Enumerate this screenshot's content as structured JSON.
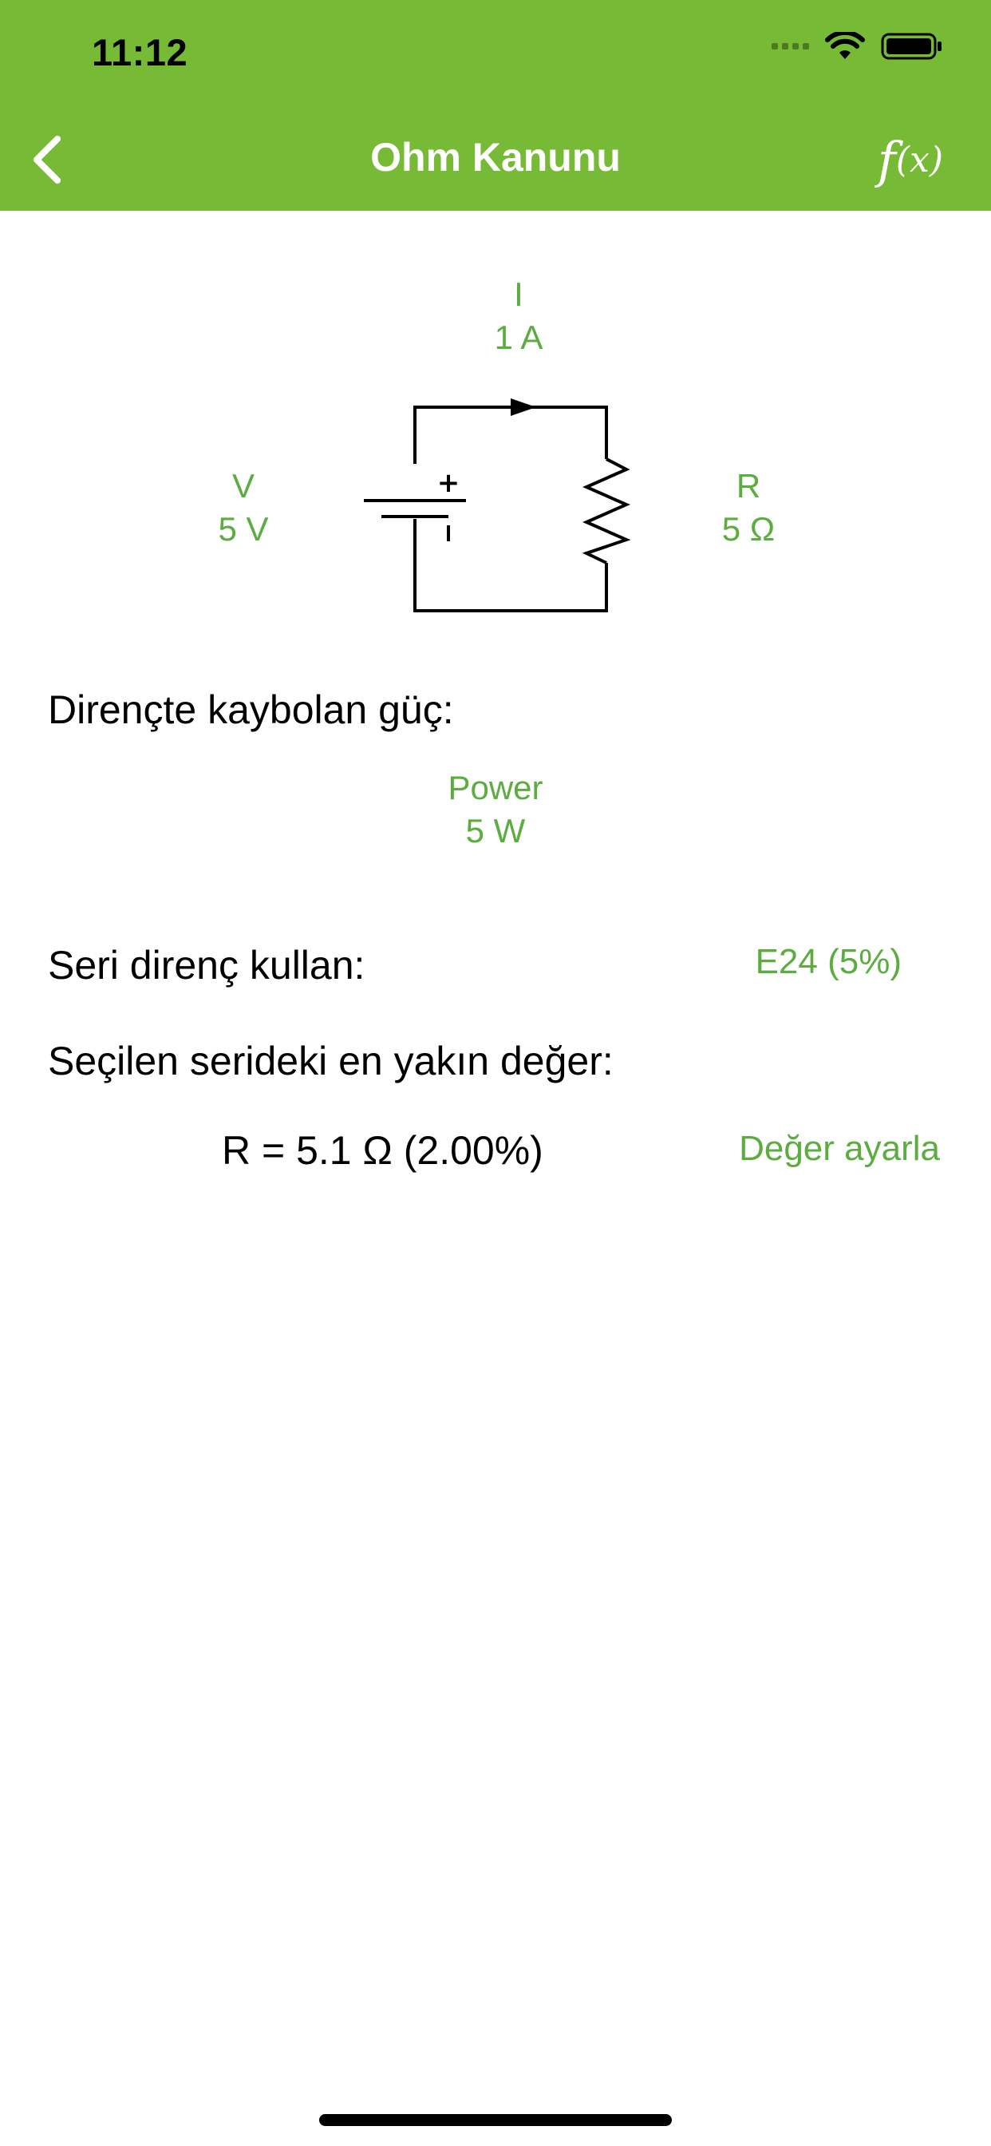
{
  "status_bar": {
    "time": "11:12"
  },
  "nav": {
    "title": "Ohm Kanunu",
    "back_icon": "chevron-left-icon",
    "fx_label_f": "f",
    "fx_label_x": "(x)"
  },
  "circuit": {
    "current": {
      "name": "I",
      "value": "1 A"
    },
    "voltage": {
      "name": "V",
      "value": "5 V"
    },
    "resistance": {
      "name": "R",
      "value": "5 Ω"
    },
    "battery_plus": "+"
  },
  "power_section": {
    "label": "Dirençte kaybolan güç:",
    "name": "Power",
    "value": "5 W"
  },
  "series_section": {
    "label": "Seri direnç kullan:",
    "selected": "E24 (5%)"
  },
  "nearest_section": {
    "label": "Seçilen serideki en yakın değer:",
    "result": "R = 5.1 Ω (2.00%)",
    "set_button": "Değer ayarla"
  },
  "colors": {
    "accent": "#77ba35",
    "value_green": "#5cad3f",
    "text": "#000000"
  }
}
